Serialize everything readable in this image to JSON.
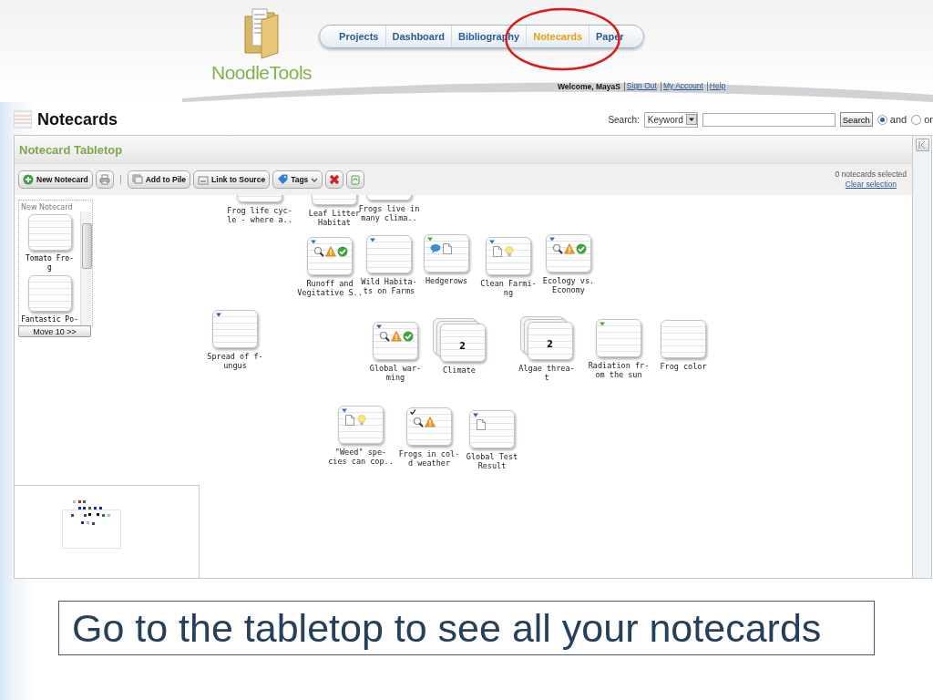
{
  "app": {
    "logo": {
      "name": "NoodleTools"
    },
    "nav": [
      {
        "label": "Projects",
        "selected": false
      },
      {
        "label": "Dashboard",
        "selected": false
      },
      {
        "label": "Bibliography",
        "selected": false
      },
      {
        "label": "Notecards",
        "selected": true
      },
      {
        "label": "Paper",
        "selected": false
      }
    ],
    "welcome": "Welcome, MayaS",
    "links": [
      "Sign Out",
      "My Account",
      "Help"
    ],
    "page_title": "Notecards",
    "search": {
      "label": "Search:",
      "field": "Keyword",
      "button": "Search",
      "options": [
        {
          "label": "and",
          "selected": true
        },
        {
          "label": "or",
          "selected": false
        }
      ]
    },
    "panel": {
      "title": "Notecard Tabletop",
      "new_notecard": "New Notecard",
      "add_to_pile": "Add to Pile",
      "link_to_source": "Link to Source",
      "tags": "Tags",
      "selected_count": "0 notecards selected",
      "clear_selection": "Clear selection"
    },
    "pile": {
      "header": "New Notecard",
      "cards": [
        {
          "label": "Tomato Fro-\ng"
        },
        {
          "label": "Fantastic Po-"
        }
      ],
      "move": "Move 10 >>"
    },
    "cards": [
      {
        "label": "Frog life cyc-\nle - where a..",
        "checked": false
      },
      {
        "label": "Leaf Litter\nHabitat",
        "checked": false
      },
      {
        "label": "Frogs live in\nmany clima..",
        "checked": false
      },
      {
        "label": "Runoff and\nVegitative S..",
        "color": "#3a6fc4",
        "checked": false,
        "icons": [
          {
            "kind": "lens"
          },
          {
            "kind": "warning"
          },
          {
            "kind": "check"
          }
        ]
      },
      {
        "label": "Wild Habita-\nts on Farms",
        "color": "#3a6fc4",
        "checked": false
      },
      {
        "label": "Hedgerows",
        "color": "#5aa02c",
        "checked": false,
        "icons": [
          {
            "kind": "comment"
          },
          {
            "kind": "page"
          }
        ]
      },
      {
        "label": "Clean Farmi-\nng",
        "color": "#3a6fc4",
        "checked": false,
        "icons": [
          {
            "kind": "page"
          },
          {
            "kind": "bulb"
          }
        ]
      },
      {
        "label": "Ecology vs.\nEconomy",
        "color": "#3a6fc4",
        "checked": false,
        "icons": [
          {
            "kind": "lens"
          },
          {
            "kind": "warning"
          },
          {
            "kind": "check"
          }
        ]
      },
      {
        "label": "Spread of f-\nungus",
        "color": "#6a3fb5",
        "checked": false
      },
      {
        "label": "Global war-\nming",
        "color": "#6a3fb5",
        "checked": false,
        "icons": [
          {
            "kind": "lens"
          },
          {
            "kind": "warning"
          },
          {
            "kind": "check"
          }
        ]
      },
      {
        "label": "Climate",
        "checked": false,
        "count": "2"
      },
      {
        "label": "Algae threa-\nt",
        "checked": false,
        "count": "2"
      },
      {
        "label": "Radiation fr-\nom the sun",
        "color": "#5aa02c",
        "checked": false
      },
      {
        "label": "Frog color",
        "checked": false
      },
      {
        "label": "\"Weed\" spe-\ncies can cop..",
        "color": "#3a6fc4",
        "checked": false,
        "icons": [
          {
            "kind": "page"
          },
          {
            "kind": "bulb"
          }
        ]
      },
      {
        "label": "Frogs in col-\nd weather",
        "checked": true,
        "icons": [
          {
            "kind": "lens"
          },
          {
            "kind": "warning"
          }
        ]
      },
      {
        "label": "Global Test\nResult",
        "color": "#6a3fb5",
        "checked": false,
        "icons": [
          {
            "kind": "page"
          }
        ]
      }
    ]
  },
  "slide": {
    "caption": "Go to the tabletop to see all your notecards"
  }
}
